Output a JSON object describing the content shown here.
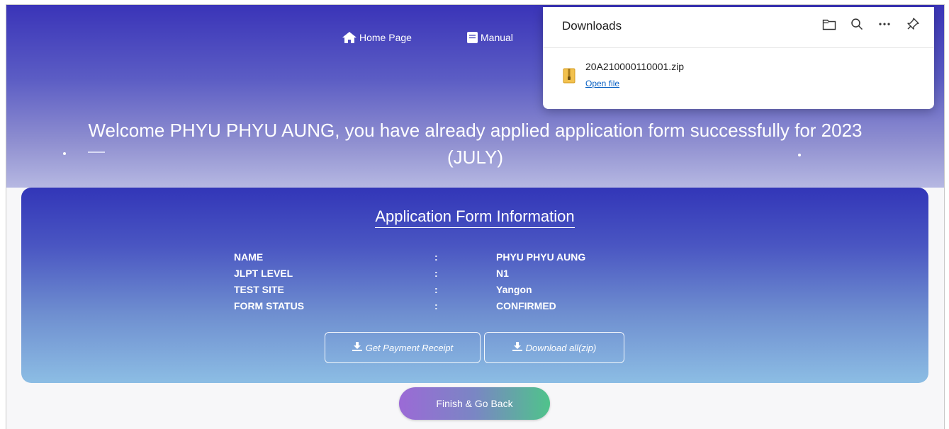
{
  "nav": {
    "home_label": "Home Page",
    "manual_label": "Manual"
  },
  "welcome": {
    "line1": "Welcome PHYU PHYU AUNG, you have already applied application form successfully for 2023",
    "line2": "(JULY)"
  },
  "card": {
    "title": "Application Form Information",
    "rows": [
      {
        "label": "NAME",
        "colon": ":",
        "value": "PHYU PHYU AUNG"
      },
      {
        "label": "JLPT LEVEL",
        "colon": ":",
        "value": "N1"
      },
      {
        "label": "TEST SITE",
        "colon": ":",
        "value": "Yangon"
      },
      {
        "label": "FORM STATUS",
        "colon": ":",
        "value": "CONFIRMED"
      }
    ],
    "receipt_button": "Get Payment Receipt",
    "zip_button": "Download all(zip)"
  },
  "finish_button": "Finish & Go Back",
  "downloads": {
    "title": "Downloads",
    "file_name": "20A210000110001.zip",
    "open_file": "Open file",
    "icons": [
      "folder-icon",
      "search-icon",
      "more-icon",
      "pin-icon"
    ]
  },
  "colors": {
    "hero_top": "#3a34b8",
    "card_top": "#3236b8",
    "card_bottom": "#8cbde4",
    "link": "#0b62c4",
    "finish_left": "#9b6ad6",
    "finish_right": "#4fc38b"
  }
}
